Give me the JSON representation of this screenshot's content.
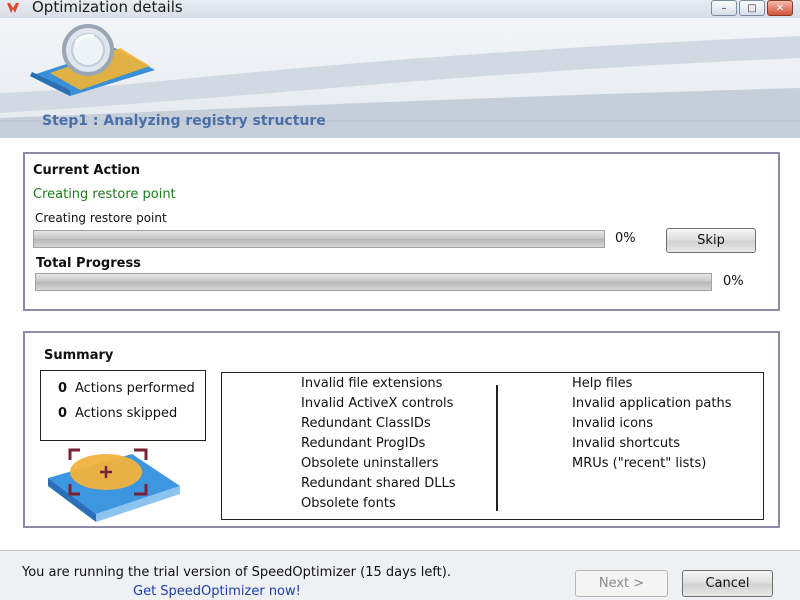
{
  "window": {
    "title": "Optimization details",
    "controls": {
      "minimize": "–",
      "maximize": "□",
      "close": "✕"
    }
  },
  "header": {
    "step_title": "Step1 : Analyzing registry structure"
  },
  "current_action": {
    "heading": "Current Action",
    "status": "Creating restore point",
    "detail": "Creating restore point",
    "action_progress_percent": "0%",
    "action_progress_value": 0,
    "skip_label": "Skip",
    "total_heading": "Total Progress",
    "total_progress_percent": "0%",
    "total_progress_value": 0
  },
  "summary": {
    "heading": "Summary",
    "counts": [
      {
        "value": "0",
        "label": "Actions performed"
      },
      {
        "value": "0",
        "label": "Actions skipped"
      }
    ],
    "left_items": [
      "Invalid file extensions",
      "Invalid ActiveX controls",
      "Redundant ClassIDs",
      "Redundant ProgIDs",
      "Obsolete uninstallers",
      "Redundant shared DLLs",
      "Obsolete fonts"
    ],
    "right_items": [
      "Help files",
      "Invalid application paths",
      "Invalid icons",
      "Invalid shortcuts",
      "MRUs (\"recent\" lists)"
    ]
  },
  "footer": {
    "trial_text": "You are running the trial version of SpeedOptimizer (15 days left).",
    "link_text": "Get SpeedOptimizer now!",
    "next_label": "Next >",
    "cancel_label": "Cancel"
  },
  "colors": {
    "step_title": "#4a6fa8",
    "status_green": "#1d7d1d",
    "panel_border": "#8d8ca8",
    "link": "#1b3fa8"
  }
}
